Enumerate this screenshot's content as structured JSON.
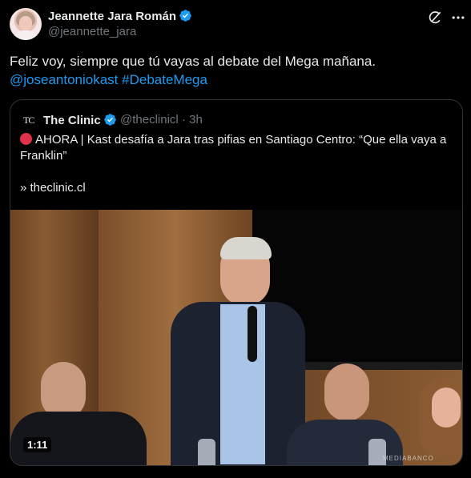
{
  "post": {
    "author_name": "Jeannette Jara Román",
    "author_handle": "@jeannette_jara",
    "text_plain": "Feliz voy, siempre que tú vayas al debate del Mega mañana.",
    "mention": "@joseantoniokast",
    "hashtag": "#DebateMega",
    "icons": [
      "grok-icon",
      "more-icon",
      "verified-icon"
    ]
  },
  "quote": {
    "logo": "TC",
    "name": "The Clinic",
    "handle": "@theclinicl",
    "time_sep": "·",
    "time": "3h",
    "text": "AHORA | Kast desafía a Jara tras pifias en Santiago Centro: “Que ella vaya a Franklin”",
    "link": "» theclinic.cl",
    "video": {
      "duration": "1:11",
      "watermark": "MEDIABANCO"
    }
  },
  "colors": {
    "background": "#000000",
    "text": "#e7e9ea",
    "secondary": "#71767b",
    "link": "#1d9bf0",
    "verified": "#1d9bf0",
    "border": "#2f3336"
  }
}
